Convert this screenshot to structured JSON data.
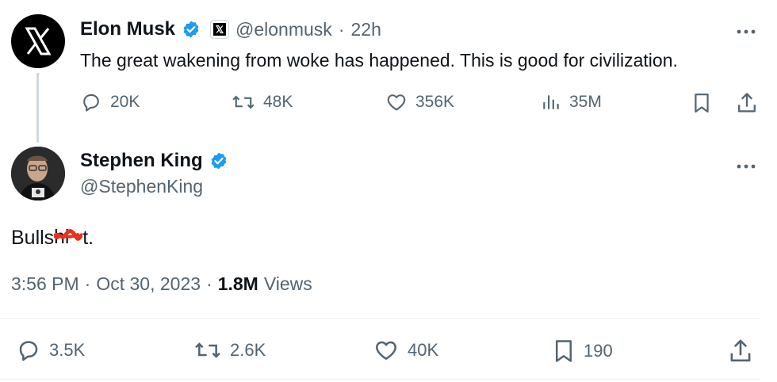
{
  "parent_tweet": {
    "author_name": "Elon Musk",
    "handle": "@elonmusk",
    "separator": "·",
    "time_ago": "22h",
    "text": "The great wakening from woke has happened. This is good for civilization.",
    "actions": {
      "replies": "20K",
      "reposts": "48K",
      "likes": "356K",
      "views": "35M"
    },
    "avatar_icon": "x-logo-icon",
    "affiliate_badge_icon": "x-affiliate-badge-icon",
    "verified_badge_icon": "verified-badge-icon"
  },
  "main_tweet": {
    "author_name": "Stephen King",
    "handle": "@StephenKing",
    "text_prefix": "Bulls",
    "text_suffix": "t.",
    "meta_time": "3:56 PM",
    "meta_sep1": "·",
    "meta_date": "Oct 30, 2023",
    "meta_sep2": "·",
    "views_count": "1.8M",
    "views_label": "Views",
    "actions": {
      "replies": "3.5K",
      "reposts": "2.6K",
      "likes": "40K",
      "bookmarks": "190"
    },
    "verified_badge_icon": "verified-badge-icon"
  },
  "colors": {
    "verified_blue": "#1d9bf0",
    "muted_gray": "#536471",
    "thread_line": "#cfd9de",
    "redaction_red": "#e8321d"
  }
}
